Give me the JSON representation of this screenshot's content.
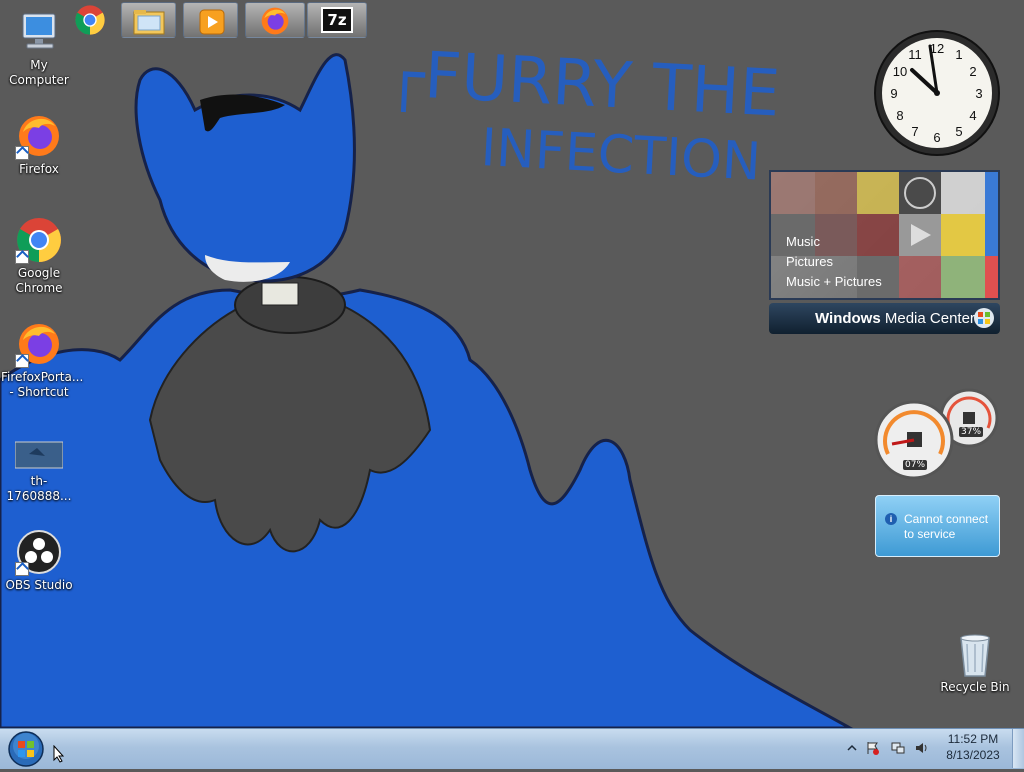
{
  "desktop": {
    "icons": [
      {
        "label": "My Computer",
        "icon": "computer-icon"
      },
      {
        "label": "Firefox",
        "icon": "firefox-icon"
      },
      {
        "label": "Google Chrome",
        "icon": "chrome-icon"
      },
      {
        "label": "FirefoxPorta... - Shortcut",
        "icon": "firefox-portable-icon"
      },
      {
        "label": "th-1760888...",
        "icon": "image-thumbnail-icon"
      },
      {
        "label": "OBS Studio",
        "icon": "obs-icon"
      },
      {
        "label": "Recycle Bin",
        "icon": "recycle-bin-icon"
      }
    ],
    "wallpaper_text": "FURRY THE INFECTION"
  },
  "gadgets": {
    "clock": {
      "time_shown": "11:52"
    },
    "media_center": {
      "items": [
        "Music",
        "Pictures",
        "Music + Pictures"
      ],
      "brand_bold": "Windows",
      "brand_rest": " Media Center"
    },
    "cpu_meter": {
      "cpu_percent": "07%",
      "memory_percent": "37%"
    },
    "weather": {
      "message_line1": "Cannot connect",
      "message_line2": "to service"
    }
  },
  "taskbar": {
    "start": "start-orb-icon",
    "pinned": [
      "chrome-icon",
      "explorer-icon",
      "media-player-icon",
      "firefox-icon",
      "7zip-icon"
    ],
    "sevenzip_label": "7z",
    "clock_time": "11:52 PM",
    "clock_date": "8/13/2023",
    "tray": [
      "show-hidden-icons-arrow",
      "action-center-flag-icon",
      "network-icon",
      "volume-icon"
    ]
  },
  "colors": {
    "accent_blue": "#1e5fd0",
    "taskbar": "#b4cbe4",
    "background": "#5a5a5a"
  }
}
